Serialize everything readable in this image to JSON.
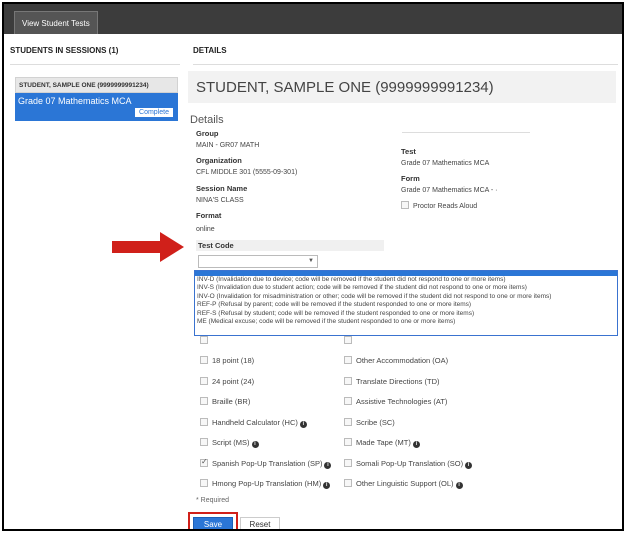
{
  "topbar": {
    "tab_label": "View Student Tests"
  },
  "left": {
    "header": "STUDENTS IN SESSIONS (1)",
    "student_name": "STUDENT, SAMPLE ONE (9999999991234)",
    "test_name": "Grade 07 Mathematics MCA",
    "status": "Complete"
  },
  "right": {
    "header": "DETAILS",
    "banner": "STUDENT, SAMPLE ONE (9999999991234)",
    "details_title": "Details"
  },
  "details": {
    "group_label": "Group",
    "group_value": "MAIN - GR07 MATH",
    "org_label": "Organization",
    "org_value": "CFL MIDDLE 301 (5555-09-301)",
    "session_label": "Session Name",
    "session_value": "NINA'S CLASS",
    "format_label": "Format",
    "format_value": "online",
    "testcode_label": "Test Code",
    "test_label": "Test",
    "test_value": "Grade 07 Mathematics MCA",
    "form_label": "Form",
    "form_value": "Grade 07 Mathematics MCA - ·",
    "proctor_reads_aloud": "Proctor Reads Aloud"
  },
  "dropdown_options": [
    "INV-D (Invalidation due to device; code will be removed if the student did not respond to one or more items)",
    "INV-S (Invalidation due to student action; code will be removed if the student did not respond to one or more items)",
    "INV-O (Invalidation for misadministration or other; code will be removed if the student did not respond to one or more items)",
    "REF-P (Refusal by parent; code will be removed if the student responded to one or more items)",
    "REF-S (Refusal by student; code will be removed if the student responded to one or more items)",
    "ME (Medical excuse; code will be removed if the student responded to one or more items)"
  ],
  "accommodations_left": [
    {
      "label": "18 point (18)",
      "checked": false,
      "info": false
    },
    {
      "label": "24 point (24)",
      "checked": false,
      "info": false
    },
    {
      "label": "Braille (BR)",
      "checked": false,
      "info": false
    },
    {
      "label": "Handheld Calculator (HC)",
      "checked": false,
      "info": true
    },
    {
      "label": "Script (MS)",
      "checked": false,
      "info": true
    },
    {
      "label": "Spanish Pop-Up Translation (SP)",
      "checked": true,
      "info": true
    },
    {
      "label": "Hmong Pop-Up Translation (HM)",
      "checked": false,
      "info": true
    }
  ],
  "accommodations_right": [
    {
      "label": "Other Accommodation (OA)",
      "checked": false,
      "info": false
    },
    {
      "label": "Translate Directions (TD)",
      "checked": false,
      "info": false
    },
    {
      "label": "Assistive Technologies (AT)",
      "checked": false,
      "info": false
    },
    {
      "label": "Scribe (SC)",
      "checked": false,
      "info": false
    },
    {
      "label": "Made Tape (MT)",
      "checked": false,
      "info": true
    },
    {
      "label": "Somali Pop-Up Translation (SO)",
      "checked": false,
      "info": true
    },
    {
      "label": "Other Linguistic Support (OL)",
      "checked": false,
      "info": true
    }
  ],
  "form": {
    "required_note": "* Required",
    "save_label": "Save",
    "reset_label": "Reset"
  },
  "colors": {
    "accent": "#2b76d6",
    "highlight_red": "#d0201a",
    "topbar": "#3c3c3c"
  }
}
